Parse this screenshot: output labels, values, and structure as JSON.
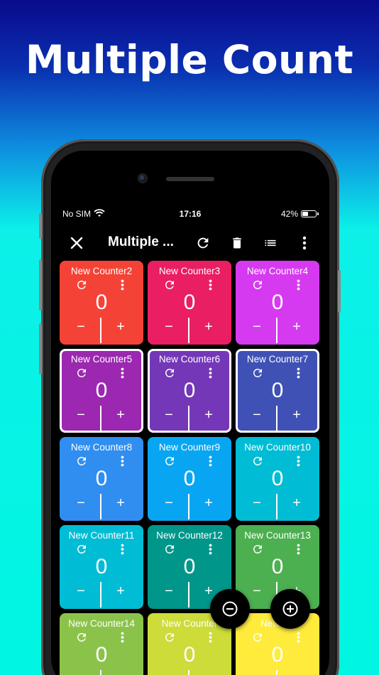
{
  "headline": "Multiple Count",
  "status_bar": {
    "carrier": "No SIM",
    "time": "17:16",
    "battery_percent": "42%",
    "battery_level": 0.42
  },
  "toolbar": {
    "title": "Multiple ...",
    "icons": [
      "close-icon",
      "refresh-icon",
      "delete-icon",
      "list-icon",
      "more-vert-icon"
    ]
  },
  "counter_controls": {
    "minus": "−",
    "plus": "+"
  },
  "counters": [
    {
      "name": "New Counter2",
      "value": "0",
      "color": "#f44336",
      "selected": false
    },
    {
      "name": "New Counter3",
      "value": "0",
      "color": "#e91e63",
      "selected": false
    },
    {
      "name": "New Counter4",
      "value": "0",
      "color": "#d63af0",
      "selected": false
    },
    {
      "name": "New Counter5",
      "value": "0",
      "color": "#9c27b0",
      "selected": true
    },
    {
      "name": "New Counter6",
      "value": "0",
      "color": "#7437b8",
      "selected": true
    },
    {
      "name": "New Counter7",
      "value": "0",
      "color": "#3f51b5",
      "selected": true
    },
    {
      "name": "New Counter8",
      "value": "0",
      "color": "#2f8ef0",
      "selected": false
    },
    {
      "name": "New Counter9",
      "value": "0",
      "color": "#08a6f2",
      "selected": false
    },
    {
      "name": "New Counter10",
      "value": "0",
      "color": "#00bcd4",
      "selected": false
    },
    {
      "name": "New Counter11",
      "value": "0",
      "color": "#00bcd4",
      "selected": false
    },
    {
      "name": "New Counter12",
      "value": "0",
      "color": "#00968a",
      "selected": false
    },
    {
      "name": "New Counter13",
      "value": "0",
      "color": "#4caf50",
      "selected": false
    },
    {
      "name": "New Counter14",
      "value": "0",
      "color": "#8bc34a",
      "selected": false
    },
    {
      "name": "New Counter",
      "value": "0",
      "color": "#cddc39",
      "selected": false
    },
    {
      "name": "New Co",
      "value": "0",
      "color": "#ffeb3b",
      "selected": false
    }
  ],
  "fab_icons": [
    "remove-circle-icon",
    "add-circle-icon"
  ]
}
